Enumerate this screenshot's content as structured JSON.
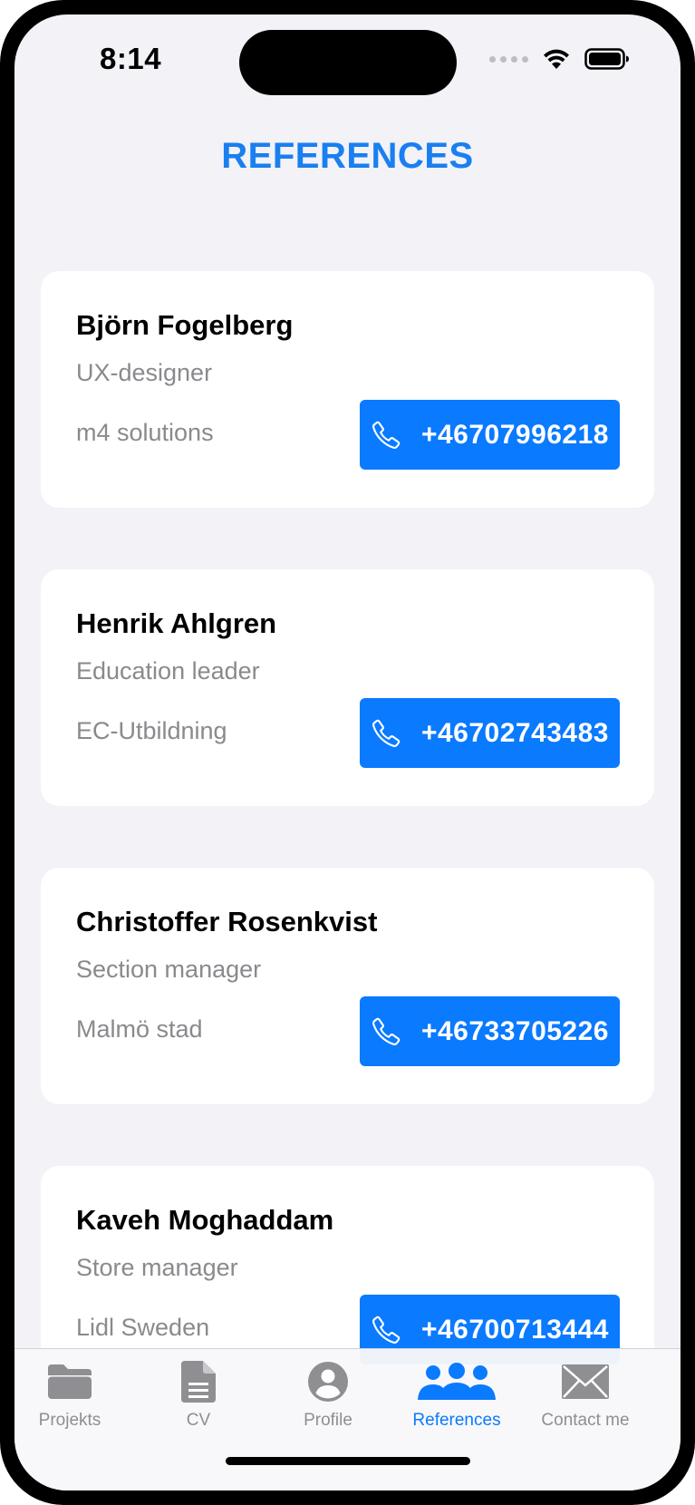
{
  "status_bar": {
    "time": "8:14"
  },
  "header": {
    "title": "REFERENCES"
  },
  "references": [
    {
      "name": "Björn Fogelberg",
      "role": "UX-designer",
      "company": "m4 solutions",
      "phone": "+46707996218"
    },
    {
      "name": "Henrik Ahlgren",
      "role": "Education leader",
      "company": "EC-Utbildning",
      "phone": "+46702743483"
    },
    {
      "name": "Christoffer Rosenkvist",
      "role": "Section manager",
      "company": "Malmö stad",
      "phone": "+46733705226"
    },
    {
      "name": "Kaveh Moghaddam",
      "role": "Store manager",
      "company": "Lidl Sweden",
      "phone": "+46700713444"
    }
  ],
  "tabbar": {
    "tabs": [
      {
        "label": "Projekts",
        "icon": "folder-icon"
      },
      {
        "label": "CV",
        "icon": "document-icon"
      },
      {
        "label": "Profile",
        "icon": "person-circle-icon"
      },
      {
        "label": "References",
        "icon": "people-icon"
      },
      {
        "label": "Contact me",
        "icon": "envelope-icon"
      }
    ],
    "active": "References"
  },
  "colors": {
    "accent": "#0A7AFF",
    "background": "#F2F2F7",
    "secondary_text": "#8A8A8E",
    "inactive_tab": "#8E8E93"
  }
}
